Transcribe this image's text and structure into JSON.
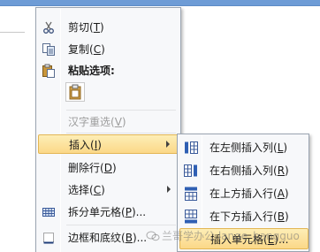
{
  "context_menu": {
    "items": [
      {
        "label": "剪切",
        "key": "T",
        "icon": "scissors-icon"
      },
      {
        "label": "复制",
        "key": "C",
        "icon": "copy-icon"
      },
      {
        "label": "粘贴选项:",
        "icon": "paste-icon"
      },
      {
        "label": "汉字重选",
        "key": "V"
      },
      {
        "label": "插入",
        "key": "I",
        "icon": "",
        "has_submenu": true
      },
      {
        "label": "删除行",
        "key": "D"
      },
      {
        "label": "选择",
        "key": "C",
        "has_submenu": true
      },
      {
        "label": "拆分单元格",
        "key": "P",
        "suffix": "...",
        "icon": "split-cells-icon"
      },
      {
        "label": "边框和底纹",
        "key": "B",
        "suffix": "...",
        "icon": "borders-icon"
      }
    ]
  },
  "submenu": {
    "items": [
      {
        "label": "在左侧插入列",
        "key": "L",
        "icon": "insert-column-left-icon"
      },
      {
        "label": "在右侧插入列",
        "key": "R",
        "icon": "insert-column-right-icon"
      },
      {
        "label": "在上方插入行",
        "key": "A",
        "icon": "insert-row-above-icon"
      },
      {
        "label": "在下方插入行",
        "key": "B",
        "icon": "insert-row-below-icon"
      },
      {
        "label": "插入单元格",
        "key": "E",
        "suffix": "...",
        "icon": "insert-cells-icon"
      }
    ]
  },
  "watermark": {
    "text": "兰哥学办公  lange_bangguo"
  },
  "colors": {
    "highlight": "#fbd888",
    "menu_bg": "#f7f8fa",
    "title_bar": "#6e9cd6"
  }
}
